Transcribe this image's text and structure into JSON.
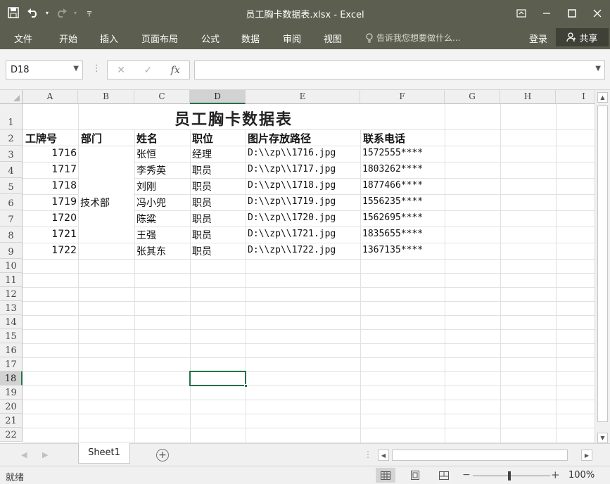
{
  "window": {
    "title": "员工胸卡数据表.xlsx - Excel",
    "qat": {
      "save_icon": "save-icon",
      "undo_icon": "undo-icon",
      "redo_icon": "redo-icon",
      "customize_icon": "customize-qat-icon"
    }
  },
  "ribbon": {
    "tabs": [
      "文件",
      "开始",
      "插入",
      "页面布局",
      "公式",
      "数据",
      "审阅",
      "视图"
    ],
    "tell_me": "告诉我您想要做什么...",
    "login": "登录",
    "share": "共享"
  },
  "formula_bar": {
    "name_box": "D18",
    "formula": ""
  },
  "columns": [
    "A",
    "B",
    "C",
    "D",
    "E",
    "F",
    "G",
    "H",
    "I"
  ],
  "rows": [
    "1",
    "2",
    "3",
    "4",
    "5",
    "6",
    "7",
    "8",
    "9",
    "10",
    "11",
    "12",
    "13",
    "14",
    "15",
    "16",
    "17",
    "18",
    "19",
    "20",
    "21",
    "22"
  ],
  "sheet": {
    "title": "员工胸卡数据表",
    "headers": [
      "工牌号",
      "部门",
      "姓名",
      "职位",
      "图片存放路径",
      "联系电话"
    ],
    "department": "技术部",
    "records": [
      {
        "id": "1716",
        "name": "张恒",
        "position": "经理",
        "path": "D:\\\\zp\\\\1716.jpg",
        "phone": "1572555****"
      },
      {
        "id": "1717",
        "name": "李秀英",
        "position": "职员",
        "path": "D:\\\\zp\\\\1717.jpg",
        "phone": "1803262****"
      },
      {
        "id": "1718",
        "name": "刘刚",
        "position": "职员",
        "path": "D:\\\\zp\\\\1718.jpg",
        "phone": "1877466****"
      },
      {
        "id": "1719",
        "name": "冯小兜",
        "position": "职员",
        "path": "D:\\\\zp\\\\1719.jpg",
        "phone": "1556235****"
      },
      {
        "id": "1720",
        "name": "陈粱",
        "position": "职员",
        "path": "D:\\\\zp\\\\1720.jpg",
        "phone": "1562695****"
      },
      {
        "id": "1721",
        "name": "王强",
        "position": "职员",
        "path": "D:\\\\zp\\\\1721.jpg",
        "phone": "1835655****"
      },
      {
        "id": "1722",
        "name": "张其东",
        "position": "职员",
        "path": "D:\\\\zp\\\\1722.jpg",
        "phone": "1367135****"
      }
    ]
  },
  "sheet_tabs": {
    "active": "Sheet1"
  },
  "status_bar": {
    "ready": "就绪",
    "zoom": "100%",
    "zoom_level": 1.0
  },
  "colors": {
    "titlebar": "#5c5e4f",
    "selection": "#217346"
  }
}
